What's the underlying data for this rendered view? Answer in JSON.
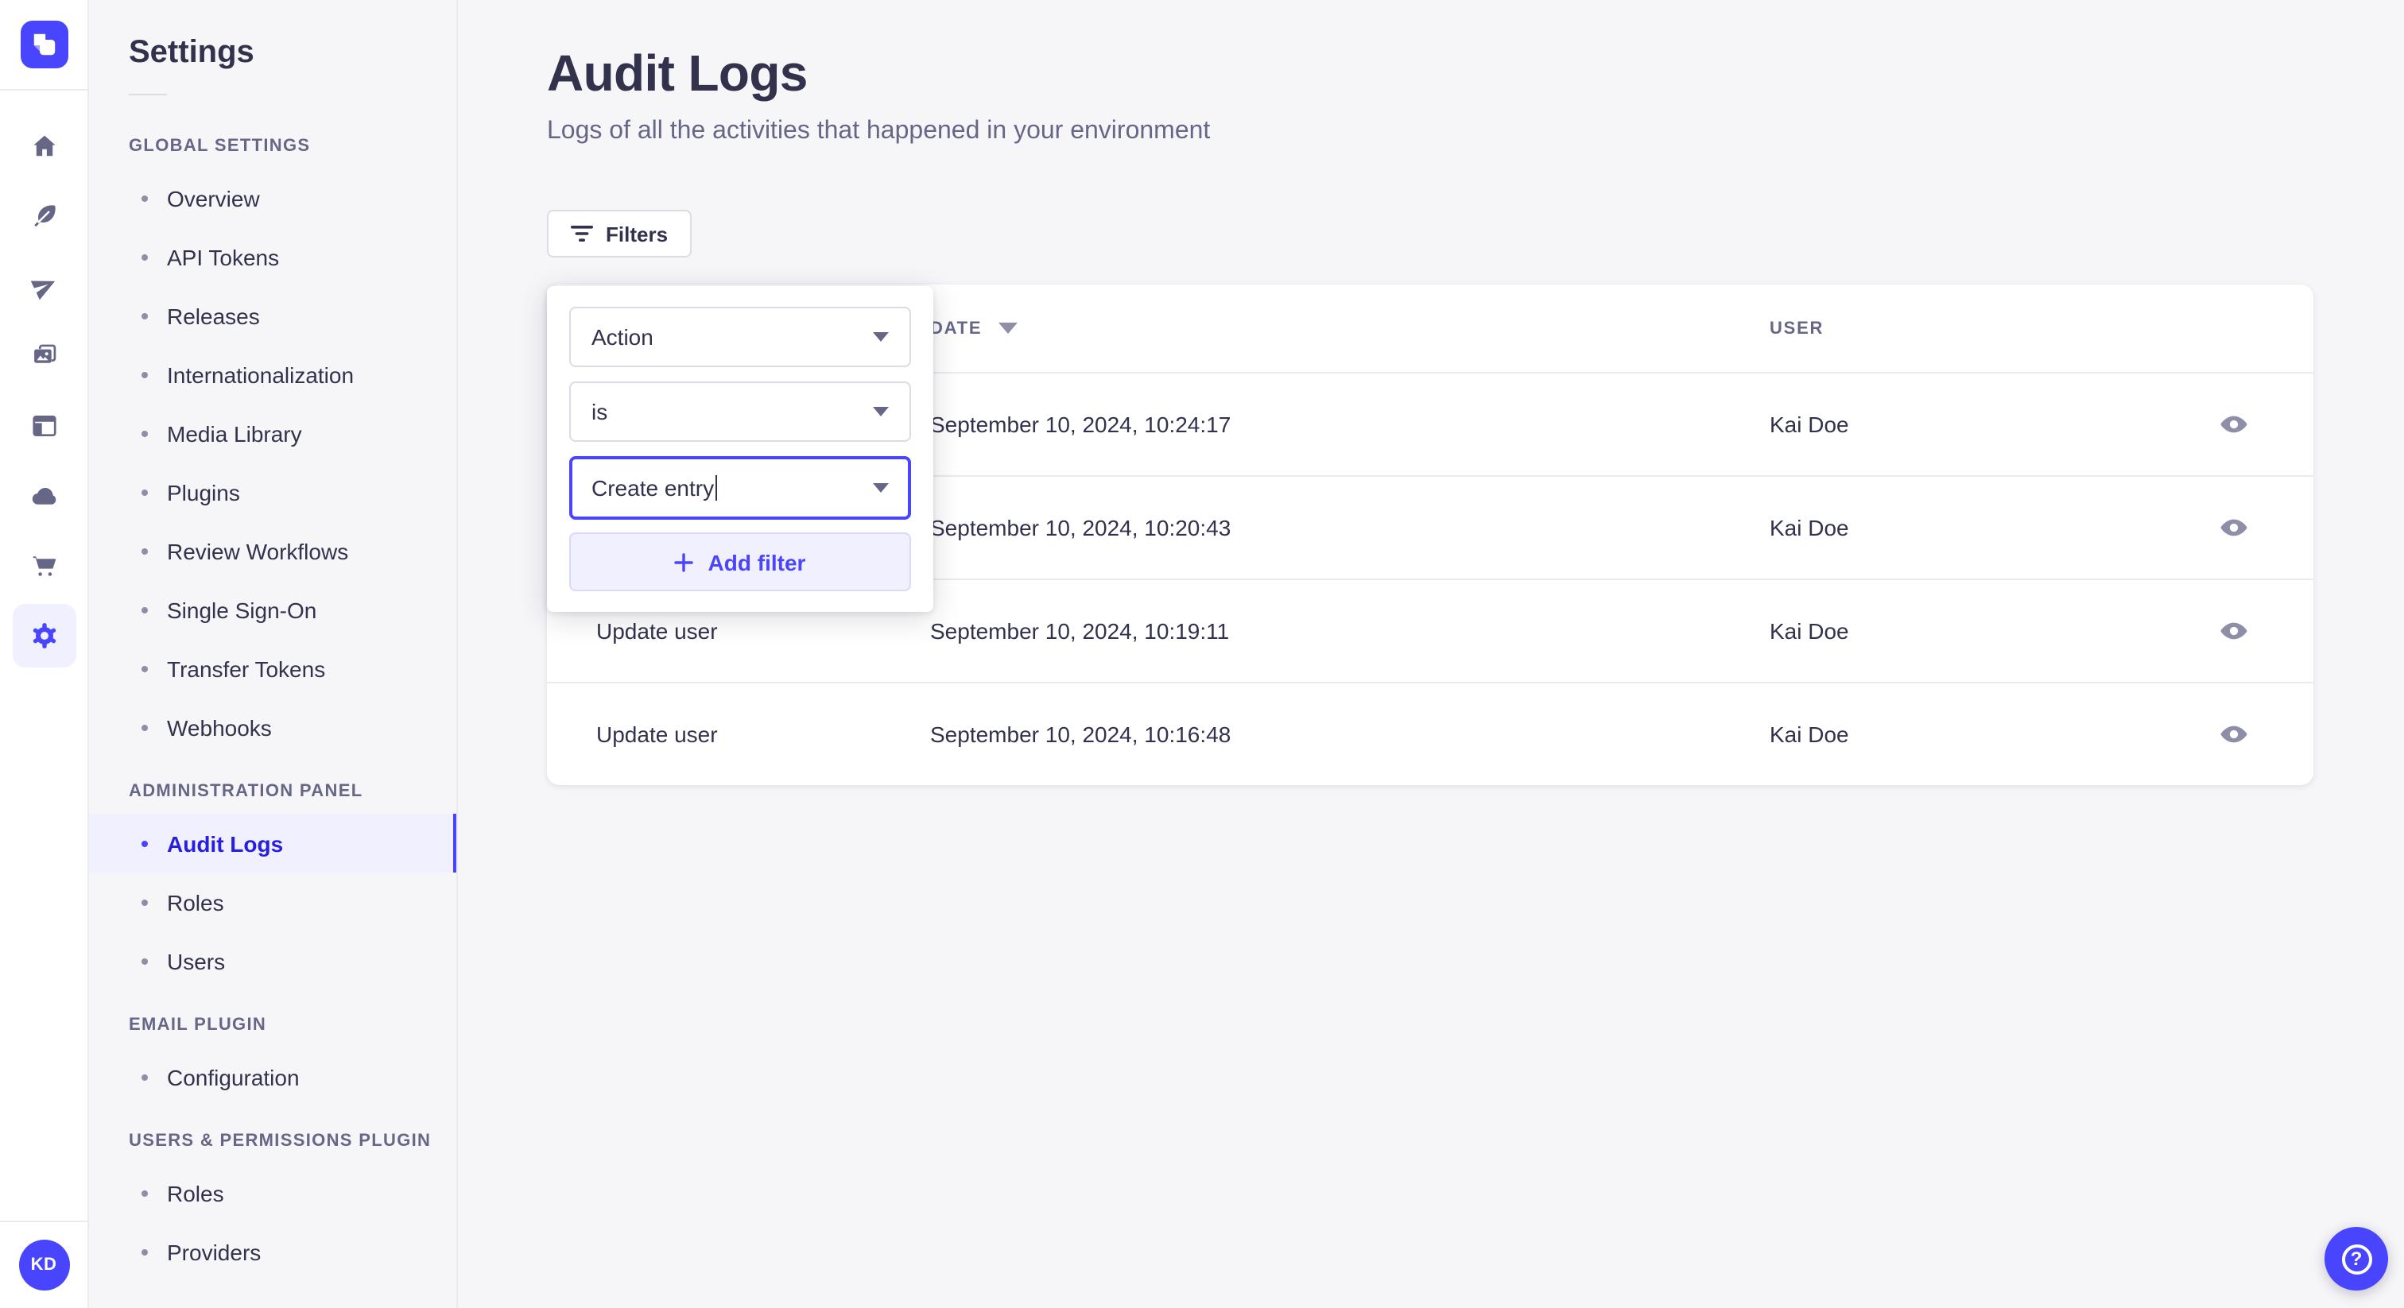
{
  "colors": {
    "accent": "#4945ff",
    "accent_dark_text": "#271fe0",
    "accent_light_bg": "#f0f0ff",
    "page_bg": "#f6f6f9",
    "text": "#32324d",
    "text_muted": "#666687",
    "border": "#dcdce4",
    "row_border": "#eaeaef"
  },
  "rail": {
    "icons": [
      {
        "name": "home-icon",
        "active": false
      },
      {
        "name": "feather-icon",
        "active": false
      },
      {
        "name": "paper-plane-icon",
        "active": false
      },
      {
        "name": "media-library-icon",
        "active": false
      },
      {
        "name": "layout-icon",
        "active": false
      },
      {
        "name": "cloud-icon",
        "active": false
      },
      {
        "name": "cart-icon",
        "active": false
      },
      {
        "name": "settings-gear-icon",
        "active": true
      }
    ],
    "avatar_initials": "KD"
  },
  "subnav": {
    "title": "Settings",
    "sections": [
      {
        "label": "GLOBAL SETTINGS",
        "items": [
          {
            "label": "Overview",
            "active": false
          },
          {
            "label": "API Tokens",
            "active": false
          },
          {
            "label": "Releases",
            "active": false
          },
          {
            "label": "Internationalization",
            "active": false
          },
          {
            "label": "Media Library",
            "active": false
          },
          {
            "label": "Plugins",
            "active": false
          },
          {
            "label": "Review Workflows",
            "active": false
          },
          {
            "label": "Single Sign-On",
            "active": false
          },
          {
            "label": "Transfer Tokens",
            "active": false
          },
          {
            "label": "Webhooks",
            "active": false
          }
        ]
      },
      {
        "label": "ADMINISTRATION PANEL",
        "items": [
          {
            "label": "Audit Logs",
            "active": true
          },
          {
            "label": "Roles",
            "active": false
          },
          {
            "label": "Users",
            "active": false
          }
        ]
      },
      {
        "label": "EMAIL PLUGIN",
        "items": [
          {
            "label": "Configuration",
            "active": false
          }
        ]
      },
      {
        "label": "USERS & PERMISSIONS PLUGIN",
        "items": [
          {
            "label": "Roles",
            "active": false
          },
          {
            "label": "Providers",
            "active": false
          }
        ]
      }
    ]
  },
  "main": {
    "title": "Audit Logs",
    "subtitle": "Logs of all the activities that happened in your environment",
    "filters_button": "Filters"
  },
  "filter_popover": {
    "field": "Action",
    "operator": "is",
    "value": "Create entry",
    "add_filter_label": "Add filter"
  },
  "table": {
    "columns": {
      "action": "",
      "date": "DATE",
      "user": "USER"
    },
    "date_sorted_desc": true,
    "rows": [
      {
        "action": "",
        "date": "September 10, 2024, 10:24:17",
        "user": "Kai Doe"
      },
      {
        "action": "",
        "date": "September 10, 2024, 10:20:43",
        "user": "Kai Doe"
      },
      {
        "action": "Update user",
        "date": "September 10, 2024, 10:19:11",
        "user": "Kai Doe"
      },
      {
        "action": "Update user",
        "date": "September 10, 2024, 10:16:48",
        "user": "Kai Doe"
      }
    ]
  },
  "help": {
    "label": "?"
  }
}
